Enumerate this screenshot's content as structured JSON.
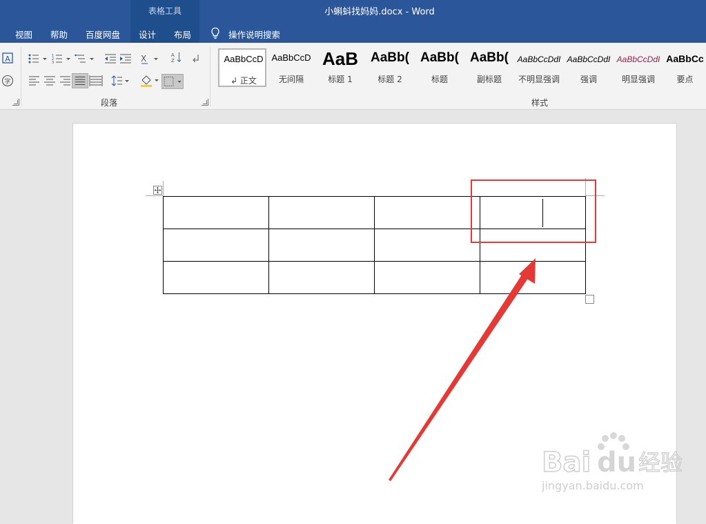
{
  "titlebar": {
    "context_group": "表格工具",
    "document_title": "小蝌蚪找妈妈.docx  -  Word"
  },
  "tabs": [
    "视图",
    "帮助",
    "百度网盘",
    "设计",
    "布局"
  ],
  "tell_me": {
    "label": "操作说明搜索",
    "icon": "lightbulb-icon"
  },
  "ribbon": {
    "paragraph_group_label": "段落",
    "styles_group_label": "样式",
    "styles": [
      {
        "sample": "AaBbCcD",
        "name": "↲ 正文",
        "active": true
      },
      {
        "sample": "AaBbCcD",
        "name": "无间隔"
      },
      {
        "sample": "AaB",
        "name": "标题 1"
      },
      {
        "sample": "AaBb(",
        "name": "标题 2"
      },
      {
        "sample": "AaBb(",
        "name": "标题"
      },
      {
        "sample": "AaBb(",
        "name": "副标题"
      },
      {
        "sample": "AaBbCcDdI",
        "name": "不明显强调"
      },
      {
        "sample": "AaBbCcDdI",
        "name": "强调"
      },
      {
        "sample": "AaBbCcDdI",
        "name": "明显强调"
      },
      {
        "sample": "AaBbCc",
        "name": "要点"
      }
    ]
  },
  "document": {
    "table": {
      "rows": 3,
      "cols": 4
    }
  },
  "watermark": {
    "brand": "Bai du 经验",
    "url": "jingyan.baidu.com"
  },
  "colors": {
    "ribbon_blue": "#2b579a",
    "annotation_red": "#e53935"
  }
}
